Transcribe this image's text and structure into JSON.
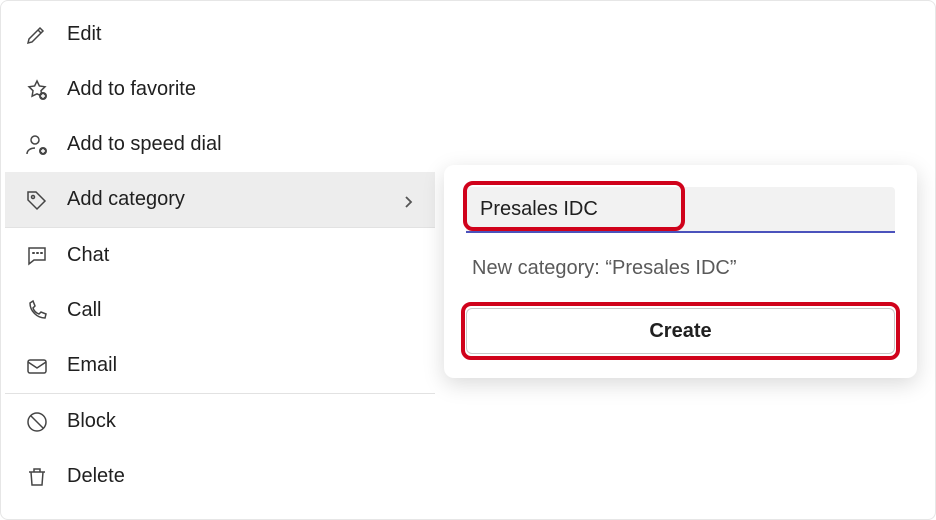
{
  "menu": {
    "edit": "Edit",
    "favorite": "Add to favorite",
    "speed_dial": "Add to speed dial",
    "add_category": "Add category",
    "chat": "Chat",
    "call": "Call",
    "email": "Email",
    "block": "Block",
    "delete": "Delete"
  },
  "flyout": {
    "input_value": "Presales IDC",
    "new_category_label": "New category: “Presales IDC”",
    "create_label": "Create"
  }
}
